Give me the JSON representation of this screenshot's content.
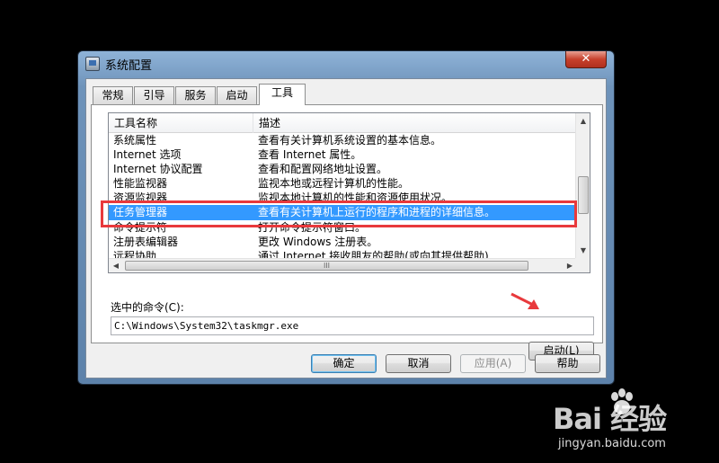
{
  "window": {
    "title": "系统配置",
    "close_glyph": "✕"
  },
  "tabs": [
    {
      "label": "常规"
    },
    {
      "label": "引导"
    },
    {
      "label": "服务"
    },
    {
      "label": "启动"
    },
    {
      "label": "工具",
      "active": true
    }
  ],
  "tools_list": {
    "columns": [
      "工具名称",
      "描述"
    ],
    "rows": [
      {
        "name": "系统属性",
        "desc": "查看有关计算机系统设置的基本信息。"
      },
      {
        "name": "Internet 选项",
        "desc": "查看 Internet 属性。"
      },
      {
        "name": "Internet 协议配置",
        "desc": "查看和配置网络地址设置。"
      },
      {
        "name": "性能监视器",
        "desc": "监视本地或远程计算机的性能。"
      },
      {
        "name": "资源监视器",
        "desc": "监视本地计算机的性能和资源使用状况。"
      },
      {
        "name": "任务管理器",
        "desc": "查看有关计算机上运行的程序和进程的详细信息。",
        "selected": true
      },
      {
        "name": "命令提示符",
        "desc": "打开命令提示符窗口。"
      },
      {
        "name": "注册表编辑器",
        "desc": "更改 Windows 注册表。"
      },
      {
        "name": "远程协助",
        "desc": "通过 Internet 接收朋友的帮助(或向其提供帮助)"
      }
    ],
    "hscroll_grip": "III"
  },
  "command": {
    "label": "选中的命令(C):",
    "value": "C:\\Windows\\System32\\taskmgr.exe"
  },
  "buttons": {
    "launch": "启动(L)",
    "ok": "确定",
    "cancel": "取消",
    "apply": "应用(A)",
    "help": "帮助"
  },
  "watermark": {
    "brand": "Bai 经验",
    "url": "jingyan.baidu.com"
  },
  "colors": {
    "selection": "#3399ff",
    "highlight_box": "#e8393c",
    "arrow": "#e8393c"
  }
}
